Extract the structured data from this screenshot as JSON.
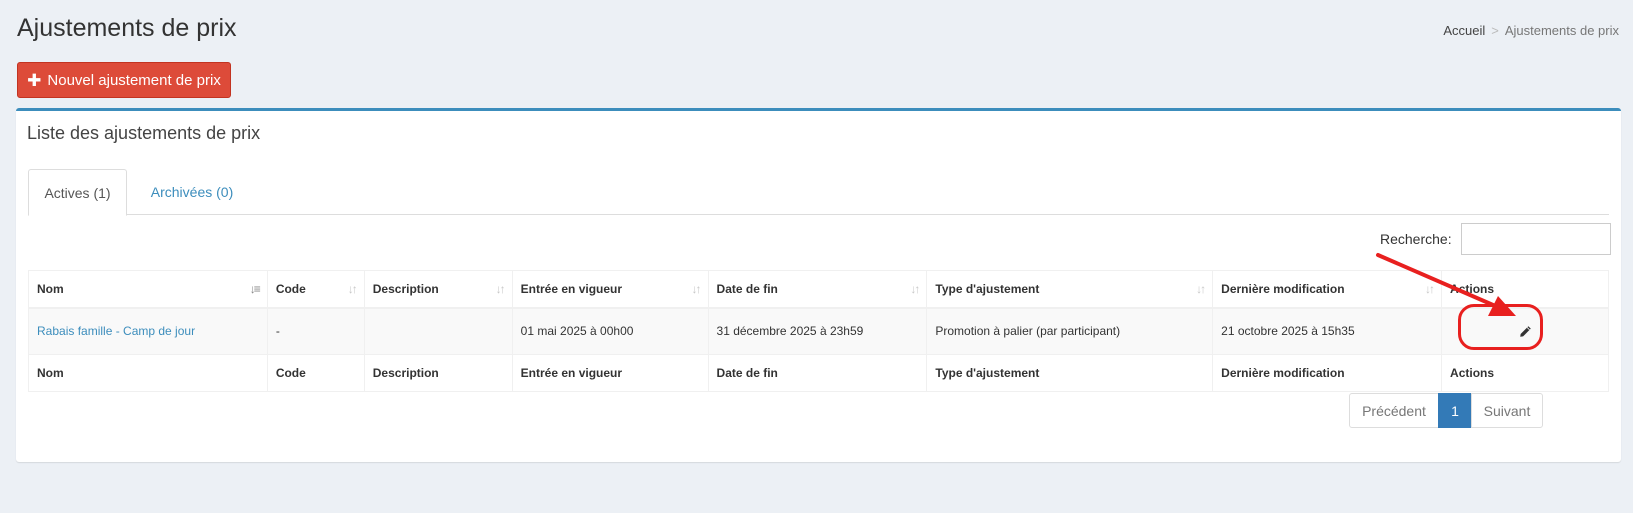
{
  "header": {
    "title": "Ajustements de prix",
    "breadcrumb": {
      "home": "Accueil",
      "separator": ">",
      "current": "Ajustements de prix"
    }
  },
  "toolbar": {
    "new_label": "Nouvel ajustement de prix"
  },
  "box": {
    "title": "Liste des ajustements de prix",
    "tabs": [
      {
        "label": "Actives (1)",
        "active": true
      },
      {
        "label": "Archivées (0)",
        "active": false
      }
    ]
  },
  "search": {
    "label": "Recherche:",
    "value": "",
    "placeholder": ""
  },
  "table": {
    "columns": [
      "Nom",
      "Code",
      "Description",
      "Entrée en vigueur",
      "Date de fin",
      "Type d'ajustement",
      "Dernière modification",
      "Actions"
    ],
    "rows": [
      {
        "nom": "Rabais famille - Camp de jour",
        "code": "-",
        "description": "",
        "entree": "01 mai 2025 à 00h00",
        "fin": "31 décembre 2025 à 23h59",
        "type": "Promotion à palier (par participant)",
        "modification": "21 octobre 2025 à 15h35"
      }
    ]
  },
  "pagination": {
    "prev": "Précédent",
    "current": "1",
    "next": "Suivant"
  },
  "icons": {
    "new": "plus-icon",
    "edit": "pencil-icon",
    "sort": "sort-icon"
  },
  "colors": {
    "primary": "#3c8dbc",
    "danger": "#dd4b39",
    "page_active": "#337ab7",
    "annotation": "#e8201f"
  }
}
